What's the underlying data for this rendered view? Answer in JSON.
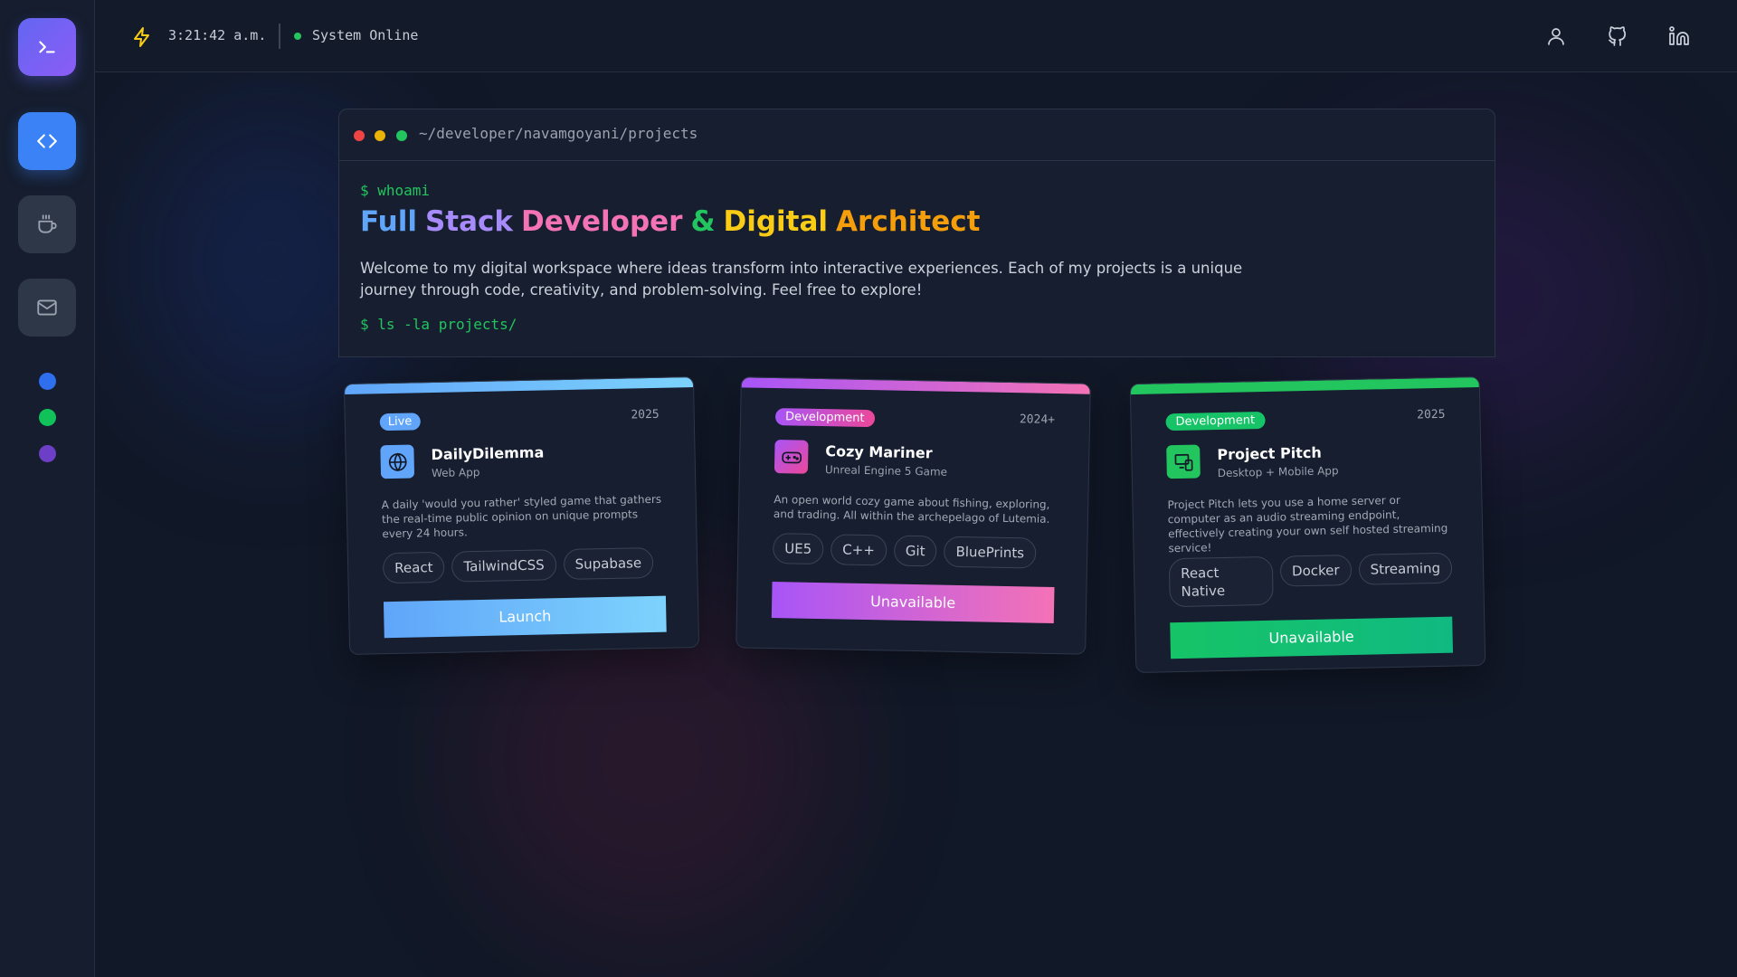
{
  "topbar": {
    "time": "3:21:42 a.m.",
    "status": "System Online"
  },
  "sidebar": {
    "items": [
      {
        "icon": "terminal-icon",
        "active": true
      },
      {
        "icon": "code-icon",
        "active": true
      },
      {
        "icon": "coffee-icon",
        "active": false
      },
      {
        "icon": "mail-icon",
        "active": false
      }
    ],
    "dots": [
      "#2f6fed",
      "#11c25a",
      "#6d3fc6"
    ]
  },
  "header_icons": [
    "user-icon",
    "github-icon",
    "linkedin-icon"
  ],
  "terminal": {
    "path": "~/developer/navamgoyani/projects",
    "command1": "$ whoami",
    "headline": [
      {
        "text": "Full",
        "color": "#60a5fa"
      },
      {
        "text": "Stack",
        "color": "#a78bfa"
      },
      {
        "text": "Developer",
        "color": "#f472b6"
      },
      {
        "text": "&",
        "color": "#22c55e"
      },
      {
        "text": "Digital",
        "color": "#facc15"
      },
      {
        "text": "Architect",
        "color": "#f59e0b"
      }
    ],
    "description": "Welcome to my digital workspace where ideas transform into interactive experiences. Each of my projects is a unique journey through code, creativity, and problem-solving. Feel free to explore!",
    "command2": "$ ls -la projects/"
  },
  "projects": [
    {
      "badge": "Live",
      "year": "2025",
      "title": "DailyDilemma",
      "subtitle": "Web App",
      "description": "A daily 'would you rather' styled game that gathers the real-time public opinion on unique prompts every 24 hours.",
      "tags": [
        "React",
        "TailwindCSS",
        "Supabase"
      ],
      "button": "Launch",
      "icon": "globe-icon"
    },
    {
      "badge": "Development",
      "year": "2024+",
      "title": "Cozy Mariner",
      "subtitle": "Unreal Engine 5 Game",
      "description": "An open world cozy game about fishing, exploring, and trading. All within the archepelago of Lutemia.",
      "tags": [
        "UE5",
        "C++",
        "Git",
        "BluePrints"
      ],
      "button": "Unavailable",
      "icon": "gamepad-icon"
    },
    {
      "badge": "Development",
      "year": "2025",
      "title": "Project Pitch",
      "subtitle": "Desktop + Mobile App",
      "description": "Project Pitch lets you use a home server or computer as an audio streaming endpoint, effectively creating your own self hosted streaming service!",
      "tags": [
        "React Native",
        "Docker",
        "Streaming"
      ],
      "button": "Unavailable",
      "icon": "devices-icon"
    }
  ]
}
